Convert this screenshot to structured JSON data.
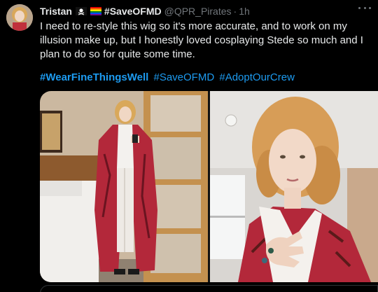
{
  "tweet": {
    "display_name": "Tristan",
    "name_tag": "#SaveOFMD",
    "handle": "@QPR_Pirates",
    "separator": "·",
    "time": "1h",
    "text": "I need to re-style this wig so it's more accurate, and to work on my illusion make up, but I honestly loved cosplaying Stede so much and I plan to do so for quite some time.",
    "hashtags": [
      "#WearFineThingsWell",
      "#SaveOFMD",
      "#AdoptOurCrew"
    ]
  },
  "icons": {
    "avatar": "avatar-photo",
    "flag": "pirate-flag-icon",
    "rainbow": "rainbow-flag-icon",
    "more": "more-options-icon"
  },
  "colors": {
    "background": "#000000",
    "text": "#e7e9ea",
    "secondary": "#71767b",
    "link": "#1d9bf0",
    "robe": "#b3283a"
  }
}
